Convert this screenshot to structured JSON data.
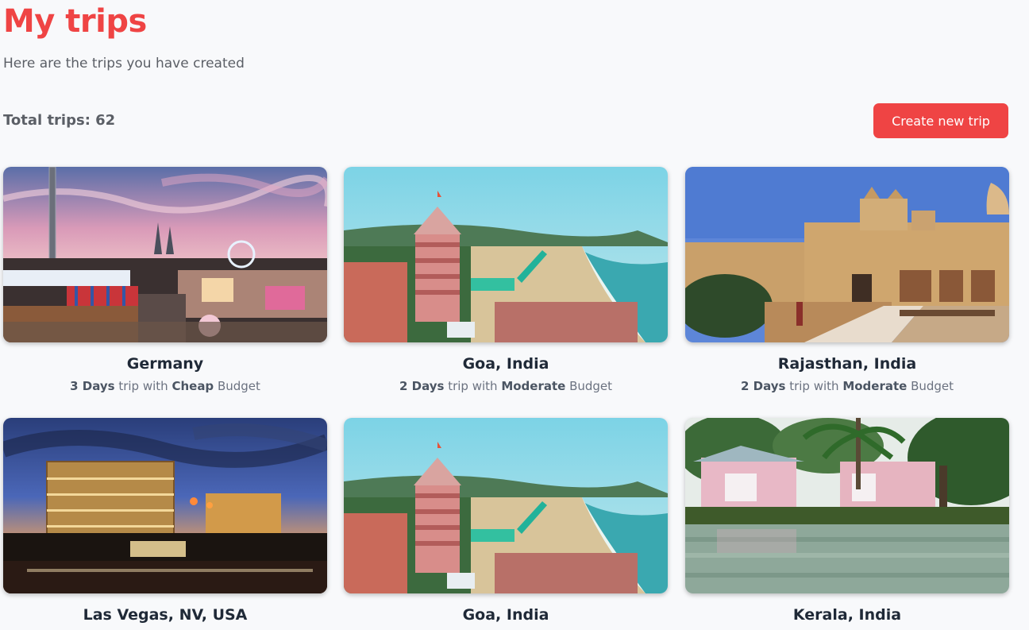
{
  "header": {
    "title": "My trips",
    "subtitle": "Here are the trips you have created"
  },
  "summary": {
    "total_label": "Total trips: 62",
    "create_button": "Create new trip"
  },
  "colors": {
    "accent": "#ef4444"
  },
  "trips": [
    {
      "title": "Germany",
      "days": "3 Days",
      "mid": " trip with ",
      "budget": "Cheap",
      "budget_suffix": " Budget",
      "scene": "festival"
    },
    {
      "title": "Goa, India",
      "days": "2 Days",
      "mid": " trip with ",
      "budget": "Moderate",
      "budget_suffix": " Budget",
      "scene": "beach"
    },
    {
      "title": "Rajasthan, India",
      "days": "2 Days",
      "mid": " trip with ",
      "budget": "Moderate",
      "budget_suffix": " Budget",
      "scene": "fort"
    },
    {
      "title": "Las Vegas, NV, USA",
      "scene": "city-night"
    },
    {
      "title": "Goa, India",
      "scene": "beach"
    },
    {
      "title": "Kerala, India",
      "scene": "backwater"
    }
  ]
}
